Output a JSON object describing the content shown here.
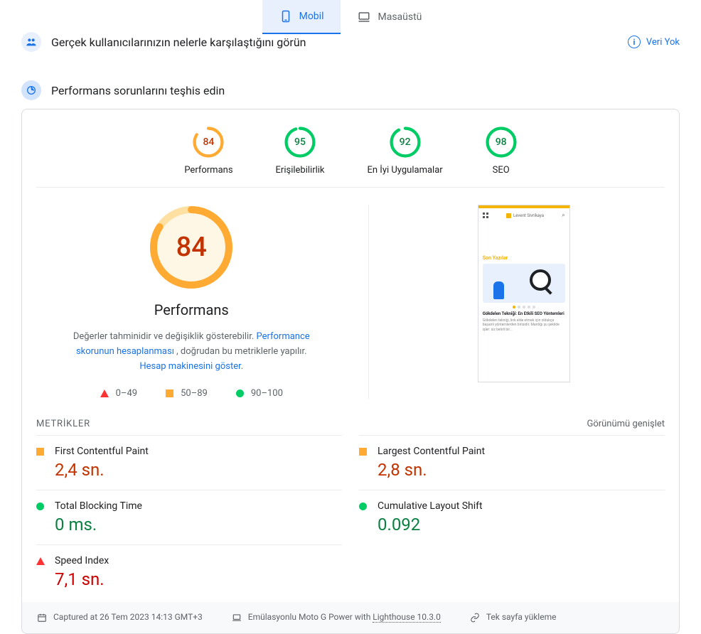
{
  "tabs": {
    "mobile": "Mobil",
    "desktop": "Masaüstü"
  },
  "header1": {
    "title": "Gerçek kullanıcılarınızın nelerle karşılaştığını görün",
    "right_label": "Veri Yok",
    "info_char": "i"
  },
  "header2": {
    "title": "Performans sorunlarını teşhis edin"
  },
  "scores": {
    "items": [
      {
        "label": "Performans",
        "value": "84",
        "color": "#fa3",
        "pct": 84,
        "txtclass": "orange-txt"
      },
      {
        "label": "Erişilebilirlik",
        "value": "95",
        "color": "#0c6",
        "pct": 95,
        "txtclass": "green-txt"
      },
      {
        "label": "En İyi Uygulamalar",
        "value": "92",
        "color": "#0c6",
        "pct": 92,
        "txtclass": "green-txt"
      },
      {
        "label": "SEO",
        "value": "98",
        "color": "#0c6",
        "pct": 98,
        "txtclass": "green-txt"
      }
    ]
  },
  "perf": {
    "value": "84",
    "pct": 84,
    "title": "Performans",
    "desc1": "Değerler tahminidir ve değişiklik gösterebilir. ",
    "link1": "Performance skorunun hesaplanması",
    "desc2": " , doğrudan bu metriklerle yapılır. ",
    "link2": "Hesap makinesini göster",
    "desc3": ".",
    "legend": {
      "r": "0–49",
      "o": "50–89",
      "g": "90–100"
    }
  },
  "screenshot": {
    "brand": "Levent Sivrikaya",
    "heading": "Son Yazılar",
    "title": "Gökdelen Tekniği: En Etkili SEO Yöntemleri",
    "text": "Gökdelen tekniği, link elde etmek için oldukça başarılı yöntemlerden birisidir. Mantiğı şu şekilde işler: siz belirli bir..."
  },
  "metrics": {
    "header": "METRİKLER",
    "expand": "Görünümü genişlet",
    "items": [
      {
        "name": "First Contentful Paint",
        "value": "2,4 sn.",
        "shape": "sq",
        "valclass": "val-orange"
      },
      {
        "name": "Largest Contentful Paint",
        "value": "2,8 sn.",
        "shape": "sq",
        "valclass": "val-orange"
      },
      {
        "name": "Total Blocking Time",
        "value": "0 ms.",
        "shape": "circ",
        "valclass": "val-green"
      },
      {
        "name": "Cumulative Layout Shift",
        "value": "0.092",
        "shape": "circ",
        "valclass": "val-green"
      },
      {
        "name": "Speed Index",
        "value": "7,1 sn.",
        "shape": "tri",
        "valclass": "val-red"
      }
    ]
  },
  "footer": {
    "captured": "Captured at 26 Tem 2023 14:13 GMT+3",
    "device_pre": "Emülasyonlu Moto G Power with ",
    "device_link": "Lighthouse 10.3.0",
    "load": "Tek sayfa yükleme"
  }
}
